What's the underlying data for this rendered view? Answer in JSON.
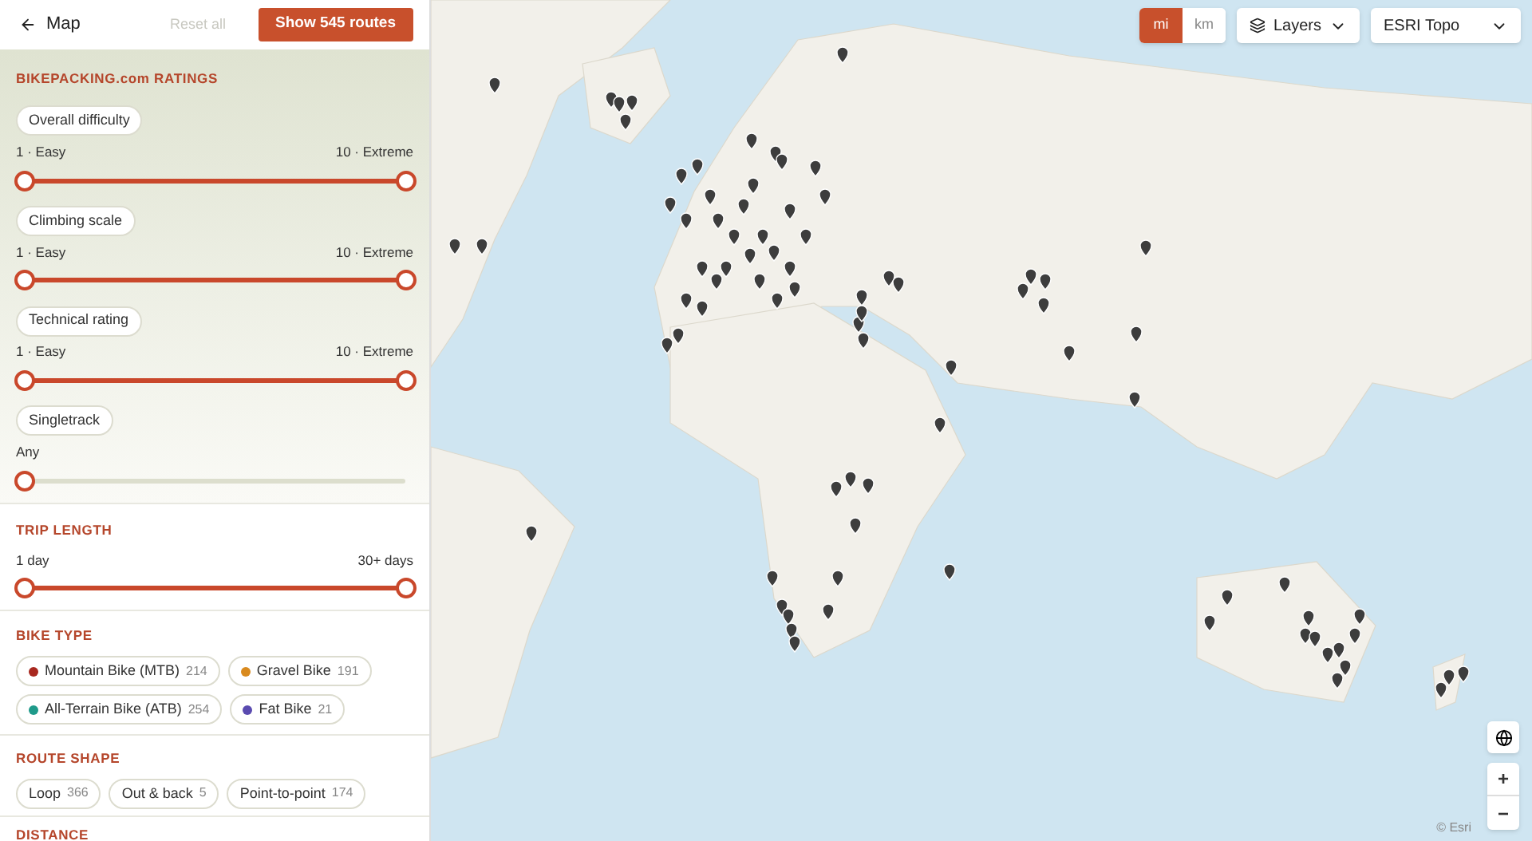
{
  "header": {
    "back_label": "Map",
    "reset_label": "Reset all",
    "show_button": "Show 545 routes"
  },
  "ratings": {
    "title": "BIKEPACKING.com RATINGS",
    "filters": [
      {
        "label": "Overall difficulty",
        "min_label": "1 · Easy",
        "max_label": "10 · Extreme",
        "handles": [
          {
            "level": 0
          },
          {
            "level": 1
          }
        ]
      },
      {
        "label": "Climbing scale",
        "min_label": "1 · Easy",
        "max_label": "10 · Extreme",
        "handles": [
          {
            "level": 0
          },
          {
            "level": 1
          }
        ]
      },
      {
        "label": "Technical rating",
        "min_label": "1 · Easy",
        "max_label": "10 · Extreme",
        "handles": [
          {
            "level": 0
          },
          {
            "level": 1
          }
        ]
      },
      {
        "label": "Singletrack",
        "min_label": "Any",
        "handles": [
          {
            "level": 0
          }
        ]
      }
    ]
  },
  "trip_length": {
    "title": "TRIP LENGTH",
    "min_label": "1 day",
    "max_label": "30+ days",
    "handles": [
      {
        "level": 0
      },
      {
        "level": 1
      }
    ]
  },
  "bike_type": {
    "title": "BIKE TYPE",
    "options": [
      {
        "label": "Mountain Bike (MTB)",
        "count": "214",
        "color": "#a8281f"
      },
      {
        "label": "Gravel Bike",
        "count": "191",
        "color": "#d98a1e"
      },
      {
        "label": "All-Terrain Bike (ATB)",
        "count": "254",
        "color": "#1f9a8a"
      },
      {
        "label": "Fat Bike",
        "count": "21",
        "color": "#5a4bb0"
      }
    ]
  },
  "route_shape": {
    "title": "ROUTE SHAPE",
    "options": [
      {
        "label": "Loop",
        "count": "366"
      },
      {
        "label": "Out & back",
        "count": "5"
      },
      {
        "label": "Point-to-point",
        "count": "174"
      }
    ]
  },
  "distance": {
    "title": "DISTANCE"
  },
  "map": {
    "units": [
      {
        "label": "mi",
        "selected": true
      },
      {
        "label": "km",
        "selected": false
      }
    ],
    "layers_label": "Layers",
    "basemap": "ESRI Topo",
    "zoom_in": "+",
    "zoom_out": "−",
    "attribution": "© Esri"
  }
}
